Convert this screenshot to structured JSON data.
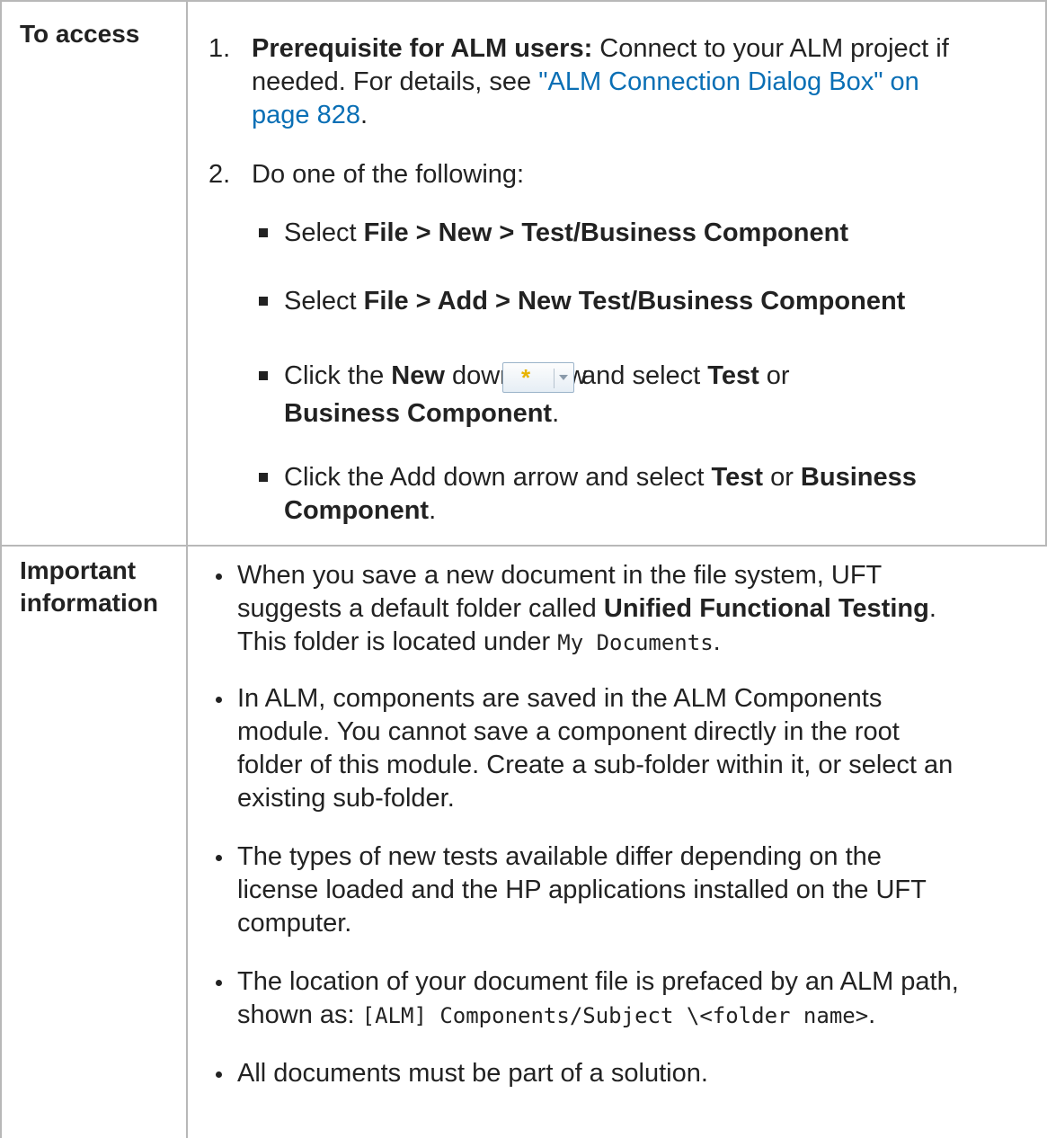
{
  "access": {
    "label": "To access",
    "step1": {
      "num": "1.",
      "bold": "Prerequisite for ALM users:",
      "text1": " Connect to your ALM project if",
      "text2": "needed. For details, see ",
      "link1": "\"ALM Connection Dialog Box\" on",
      "link2": "page 828",
      "end": "."
    },
    "step2": {
      "num": "2.",
      "text": "Do one of the following:",
      "opt1": {
        "pre": "Select ",
        "bold": "File > New > Test/Business Component"
      },
      "opt2": {
        "pre": "Select ",
        "bold": "File > Add > New Test/Business Component"
      },
      "opt3": {
        "pre": "Click the ",
        "bold1": "New",
        "mid": " down arrow",
        "post": " and select ",
        "bold2": "Test",
        "or": " or",
        "bold3": "Business Component",
        "end": "."
      },
      "opt4": {
        "pre": "Click the Add down arrow and select ",
        "bold1": "Test",
        "or": " or ",
        "bold2": "Business",
        "bold3": "Component",
        "end": "."
      }
    },
    "new_button_icon": "new-star-dropdown-icon"
  },
  "important": {
    "label": "Important information",
    "b1": {
      "l1": "When you save a new document in the file system, UFT",
      "l2pre": "suggests a default folder called ",
      "l2bold": "Unified Functional Testing",
      "l2end": ".",
      "l3pre": "This folder is located under ",
      "l3mono": "My Documents",
      "l3end": "."
    },
    "b2": {
      "l1": "In ALM, components are saved in the ALM Components",
      "l2": "module. You cannot save a component directly in the root",
      "l3": "folder of this module. Create a sub-folder within it, or select an",
      "l4": "existing sub-folder."
    },
    "b3": {
      "l1": "The types of new tests available differ depending on the",
      "l2": "license loaded and the HP applications installed on the UFT",
      "l3": "computer."
    },
    "b4": {
      "l1": "The location of your document file is prefaced by an ALM path,",
      "l2pre": "shown as: ",
      "l2mono": "[ALM] Components/Subject \\<folder name>",
      "l2end": "."
    },
    "b5": {
      "l1": "All documents must be part of a solution."
    }
  }
}
